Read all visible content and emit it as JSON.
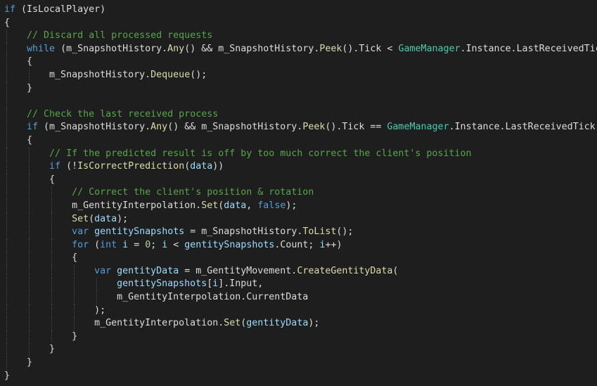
{
  "editor": {
    "theme_colors": {
      "background": "#1e1e1e",
      "text": "#dcdcdc",
      "keyword": "#569cd6",
      "comment": "#57a64a",
      "type": "#4ec9b0",
      "method": "#dcdcaa",
      "parameter": "#9cdcfe",
      "number": "#b5cea8"
    },
    "lines": [
      {
        "indent": 0,
        "tokens": [
          {
            "t": "if",
            "c": "kw"
          },
          {
            "t": " (IsLocalPlayer)",
            "c": "pl"
          }
        ]
      },
      {
        "indent": 0,
        "tokens": [
          {
            "t": "{",
            "c": "pl"
          }
        ]
      },
      {
        "indent": 1,
        "tokens": [
          {
            "t": "// Discard all processed requests",
            "c": "cm"
          }
        ]
      },
      {
        "indent": 1,
        "tokens": [
          {
            "t": "while",
            "c": "kw"
          },
          {
            "t": " (m_SnapshotHistory.",
            "c": "pl"
          },
          {
            "t": "Any",
            "c": "mth"
          },
          {
            "t": "() && m_SnapshotHistory.",
            "c": "pl"
          },
          {
            "t": "Peek",
            "c": "mth"
          },
          {
            "t": "().Tick < ",
            "c": "pl"
          },
          {
            "t": "GameManager",
            "c": "cls"
          },
          {
            "t": ".Instance.LastReceivedTick)",
            "c": "pl"
          }
        ]
      },
      {
        "indent": 1,
        "tokens": [
          {
            "t": "{",
            "c": "pl"
          }
        ]
      },
      {
        "indent": 2,
        "tokens": [
          {
            "t": "m_SnapshotHistory.",
            "c": "pl"
          },
          {
            "t": "Dequeue",
            "c": "mth"
          },
          {
            "t": "();",
            "c": "pl"
          }
        ]
      },
      {
        "indent": 1,
        "tokens": [
          {
            "t": "}",
            "c": "pl"
          }
        ]
      },
      {
        "indent": 1,
        "tokens": []
      },
      {
        "indent": 1,
        "tokens": [
          {
            "t": "// Check the last received process",
            "c": "cm"
          }
        ]
      },
      {
        "indent": 1,
        "tokens": [
          {
            "t": "if",
            "c": "kw"
          },
          {
            "t": " (m_SnapshotHistory.",
            "c": "pl"
          },
          {
            "t": "Any",
            "c": "mth"
          },
          {
            "t": "() && m_SnapshotHistory.",
            "c": "pl"
          },
          {
            "t": "Peek",
            "c": "mth"
          },
          {
            "t": "().Tick == ",
            "c": "pl"
          },
          {
            "t": "GameManager",
            "c": "cls"
          },
          {
            "t": ".Instance.LastReceivedTick)",
            "c": "pl"
          }
        ]
      },
      {
        "indent": 1,
        "tokens": [
          {
            "t": "{",
            "c": "pl"
          }
        ]
      },
      {
        "indent": 2,
        "tokens": [
          {
            "t": "// If the predicted result is off by too much correct the client's position",
            "c": "cm"
          }
        ]
      },
      {
        "indent": 2,
        "tokens": [
          {
            "t": "if",
            "c": "kw"
          },
          {
            "t": " (!",
            "c": "pl"
          },
          {
            "t": "IsCorrectPrediction",
            "c": "mth"
          },
          {
            "t": "(",
            "c": "pl"
          },
          {
            "t": "data",
            "c": "var"
          },
          {
            "t": "))",
            "c": "pl"
          }
        ]
      },
      {
        "indent": 2,
        "tokens": [
          {
            "t": "{",
            "c": "pl"
          }
        ]
      },
      {
        "indent": 3,
        "tokens": [
          {
            "t": "// Correct the client's position & rotation",
            "c": "cm"
          }
        ]
      },
      {
        "indent": 3,
        "tokens": [
          {
            "t": "m_GentityInterpolation.",
            "c": "pl"
          },
          {
            "t": "Set",
            "c": "mth"
          },
          {
            "t": "(",
            "c": "pl"
          },
          {
            "t": "data",
            "c": "var"
          },
          {
            "t": ", ",
            "c": "pl"
          },
          {
            "t": "false",
            "c": "kw"
          },
          {
            "t": ");",
            "c": "pl"
          }
        ]
      },
      {
        "indent": 3,
        "tokens": [
          {
            "t": "Set",
            "c": "mth"
          },
          {
            "t": "(",
            "c": "pl"
          },
          {
            "t": "data",
            "c": "var"
          },
          {
            "t": ");",
            "c": "pl"
          }
        ]
      },
      {
        "indent": 3,
        "tokens": [
          {
            "t": "var",
            "c": "kw"
          },
          {
            "t": " ",
            "c": "pl"
          },
          {
            "t": "gentitySnapshots",
            "c": "var"
          },
          {
            "t": " = m_SnapshotHistory.",
            "c": "pl"
          },
          {
            "t": "ToList",
            "c": "mth"
          },
          {
            "t": "();",
            "c": "pl"
          }
        ]
      },
      {
        "indent": 3,
        "tokens": [
          {
            "t": "for",
            "c": "kw"
          },
          {
            "t": " (",
            "c": "pl"
          },
          {
            "t": "int",
            "c": "kw"
          },
          {
            "t": " ",
            "c": "pl"
          },
          {
            "t": "i",
            "c": "var"
          },
          {
            "t": " = ",
            "c": "pl"
          },
          {
            "t": "0",
            "c": "num"
          },
          {
            "t": "; ",
            "c": "pl"
          },
          {
            "t": "i",
            "c": "var"
          },
          {
            "t": " < ",
            "c": "pl"
          },
          {
            "t": "gentitySnapshots",
            "c": "var"
          },
          {
            "t": ".Count; ",
            "c": "pl"
          },
          {
            "t": "i",
            "c": "var"
          },
          {
            "t": "++)",
            "c": "pl"
          }
        ]
      },
      {
        "indent": 3,
        "tokens": [
          {
            "t": "{",
            "c": "pl"
          }
        ]
      },
      {
        "indent": 4,
        "tokens": [
          {
            "t": "var",
            "c": "kw"
          },
          {
            "t": " ",
            "c": "pl"
          },
          {
            "t": "gentityData",
            "c": "var"
          },
          {
            "t": " = m_GentityMovement.",
            "c": "pl"
          },
          {
            "t": "CreateGentityData",
            "c": "mth"
          },
          {
            "t": "(",
            "c": "pl"
          }
        ]
      },
      {
        "indent": 5,
        "tokens": [
          {
            "t": "gentitySnapshots",
            "c": "var"
          },
          {
            "t": "[",
            "c": "pl"
          },
          {
            "t": "i",
            "c": "var"
          },
          {
            "t": "].Input,",
            "c": "pl"
          }
        ]
      },
      {
        "indent": 5,
        "tokens": [
          {
            "t": "m_GentityInterpolation.CurrentData",
            "c": "pl"
          }
        ]
      },
      {
        "indent": 4,
        "tokens": [
          {
            "t": ");",
            "c": "pl"
          }
        ]
      },
      {
        "indent": 4,
        "tokens": [
          {
            "t": "m_GentityInterpolation.",
            "c": "pl"
          },
          {
            "t": "Set",
            "c": "mth"
          },
          {
            "t": "(",
            "c": "pl"
          },
          {
            "t": "gentityData",
            "c": "var"
          },
          {
            "t": ");",
            "c": "pl"
          }
        ]
      },
      {
        "indent": 3,
        "tokens": [
          {
            "t": "}",
            "c": "pl"
          }
        ]
      },
      {
        "indent": 2,
        "tokens": [
          {
            "t": "}",
            "c": "pl"
          }
        ]
      },
      {
        "indent": 1,
        "tokens": [
          {
            "t": "}",
            "c": "pl"
          }
        ]
      },
      {
        "indent": 0,
        "tokens": [
          {
            "t": "}",
            "c": "pl"
          }
        ]
      }
    ]
  }
}
